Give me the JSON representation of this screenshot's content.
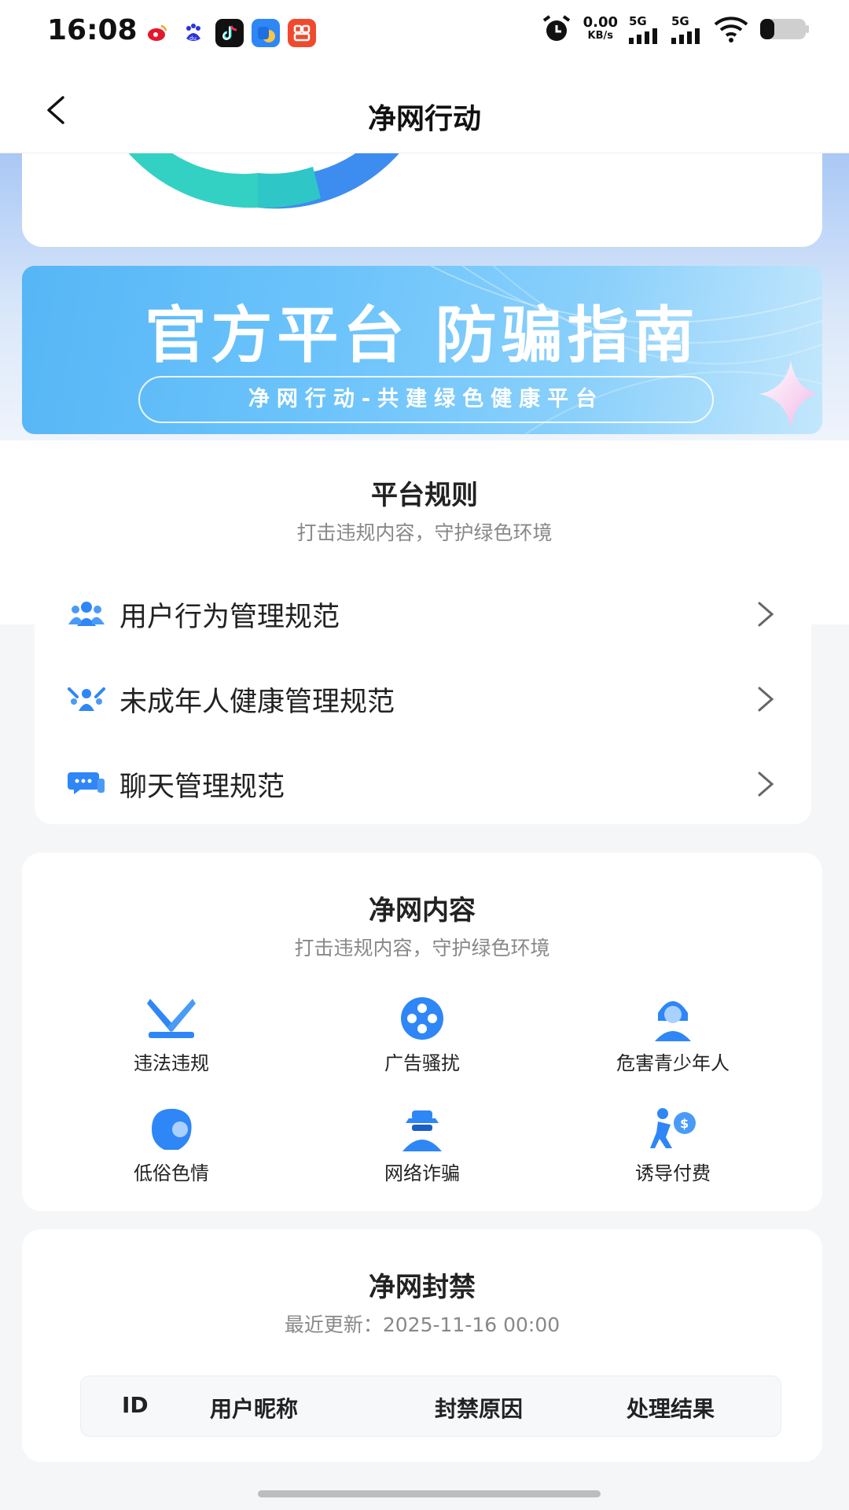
{
  "status_bar": {
    "time": "16:08",
    "net_speed_value": "0.00",
    "net_speed_unit": "KB/s",
    "sim1": "5G",
    "sim2": "5G"
  },
  "nav": {
    "title": "净网行动"
  },
  "banner": {
    "title": "官方平台 防骗指南",
    "tagline": "净网行动-共建绿色健康平台"
  },
  "rules": {
    "title": "平台规则",
    "subtitle": "打击违规内容，守护绿色环境",
    "items": [
      {
        "label": "用户行为管理规范",
        "icon": "users-icon"
      },
      {
        "label": "未成年人健康管理规范",
        "icon": "minors-icon"
      },
      {
        "label": "聊天管理规范",
        "icon": "chat-icon"
      }
    ]
  },
  "content": {
    "title": "净网内容",
    "subtitle": "打击违规内容，守护绿色环境",
    "items": [
      {
        "label": "违法违规",
        "icon": "crossed-swords-icon"
      },
      {
        "label": "广告骚扰",
        "icon": "film-reel-icon"
      },
      {
        "label": "危害青少年人",
        "icon": "youth-icon"
      },
      {
        "label": "低俗色情",
        "icon": "woman-profile-icon"
      },
      {
        "label": "网络诈骗",
        "icon": "fraudster-icon"
      },
      {
        "label": "诱导付费",
        "icon": "money-bag-icon"
      }
    ]
  },
  "bans": {
    "title": "净网封禁",
    "updated_prefix": "最近更新：",
    "updated_time": "2025-11-16 00:00",
    "columns": [
      "ID",
      "用户昵称",
      "封禁原因",
      "处理结果"
    ]
  },
  "colors": {
    "accent": "#2f86f6",
    "banner": "#62bdf8",
    "ring_teal": "#33d1c4",
    "ring_blue": "#3d8cf0"
  }
}
